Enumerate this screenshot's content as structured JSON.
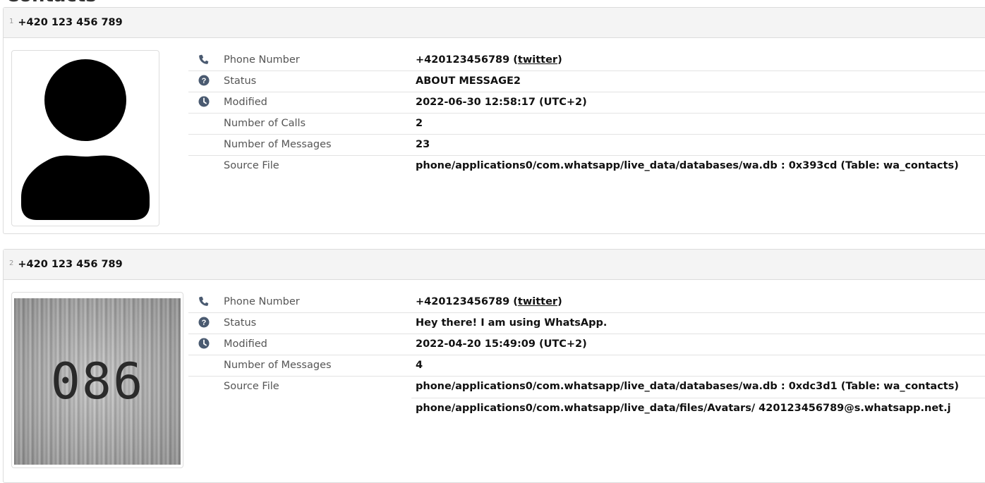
{
  "page": {
    "heading": "Contacts"
  },
  "contacts": [
    {
      "index": "1",
      "title": "+420 123 456 789",
      "avatar": {
        "type": "placeholder-silhouette"
      },
      "fields": [
        {
          "icon": "phone-icon",
          "label": "Phone Number",
          "value": "+420123456789",
          "link": "twitter"
        },
        {
          "icon": "question-circle-icon",
          "label": "Status",
          "value": "ABOUT MESSAGE2"
        },
        {
          "icon": "clock-icon",
          "label": "Modified",
          "value": "2022-06-30 12:58:17 (UTC+2)"
        },
        {
          "icon": "",
          "label": "Number of Calls",
          "value": "2"
        },
        {
          "icon": "",
          "label": "Number of Messages",
          "value": "23"
        },
        {
          "icon": "",
          "label": "Source File",
          "value": "phone/applications0/com.whatsapp/live_data/databases/wa.db : 0x393cd (Table: wa_contacts)"
        }
      ]
    },
    {
      "index": "2",
      "title": "+420 123 456 789",
      "avatar": {
        "type": "photo",
        "text": "086"
      },
      "fields": [
        {
          "icon": "phone-icon",
          "label": "Phone Number",
          "value": "+420123456789",
          "link": "twitter"
        },
        {
          "icon": "question-circle-icon",
          "label": "Status",
          "value": "Hey there! I am using WhatsApp."
        },
        {
          "icon": "clock-icon",
          "label": "Modified",
          "value": "2022-04-20 15:49:09 (UTC+2)"
        },
        {
          "icon": "",
          "label": "Number of Messages",
          "value": "4"
        },
        {
          "icon": "",
          "label": "Source File",
          "value": "phone/applications0/com.whatsapp/live_data/databases/wa.db : 0xdc3d1 (Table: wa_contacts)",
          "value2": "phone/applications0/com.whatsapp/live_data/files/Avatars/ 420123456789@s.whatsapp.net.j"
        }
      ]
    }
  ],
  "colors": {
    "icon": "#4a5a70",
    "header_bg": "#f4f4f4",
    "border": "#dcdcdc"
  }
}
